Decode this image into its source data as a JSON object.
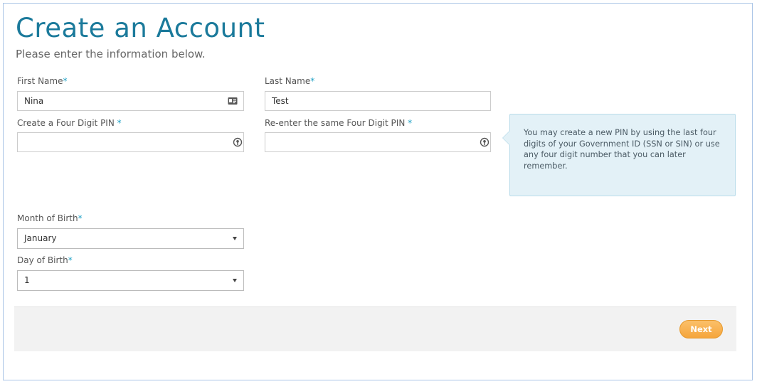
{
  "page": {
    "title": "Create an Account",
    "subtitle": "Please enter the information below."
  },
  "form": {
    "first_name": {
      "label": "First Name",
      "required_mark": "*",
      "value": "Nina",
      "icon": "contact-card-icon"
    },
    "last_name": {
      "label": "Last Name",
      "required_mark": "*",
      "value": "Test"
    },
    "pin": {
      "label": "Create a Four Digit PIN ",
      "required_mark": "*",
      "value": "",
      "icon": "key-icon"
    },
    "pin_confirm": {
      "label": "Re-enter the same Four Digit PIN ",
      "required_mark": "*",
      "value": "",
      "icon": "key-icon"
    },
    "month_of_birth": {
      "label": "Month of Birth",
      "required_mark": "*",
      "selected": "January"
    },
    "day_of_birth": {
      "label": "Day of Birth",
      "required_mark": "*",
      "selected": "1"
    }
  },
  "tooltip": {
    "text": "You may create a new PIN by using the last four digits of your Government ID (SSN or SIN) or use any four digit number that you can later remember."
  },
  "footer": {
    "next_label": "Next"
  },
  "colors": {
    "title": "#1b7a9b",
    "required": "#1a9fc4",
    "tooltip_bg": "#e3f1f7",
    "next_button": "#f5a53b"
  }
}
